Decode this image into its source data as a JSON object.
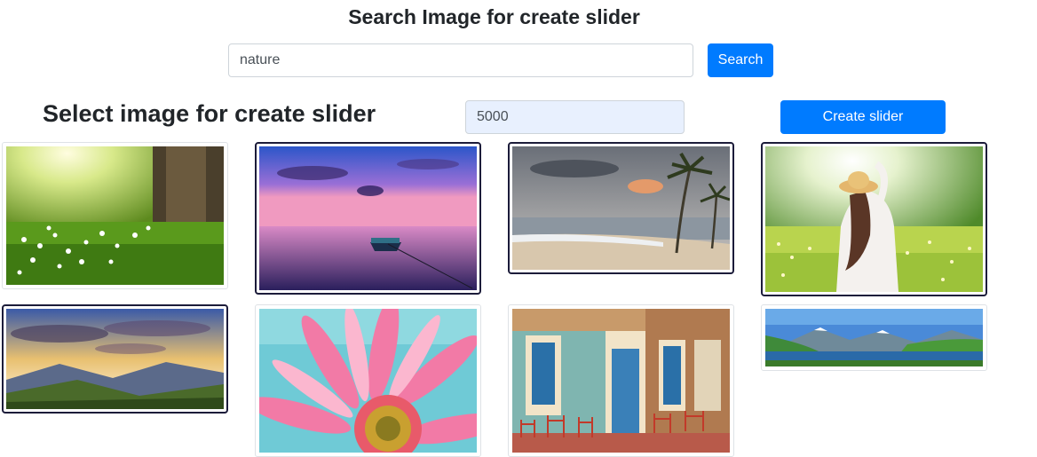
{
  "search": {
    "title": "Search Image for create slider",
    "input_value": "nature",
    "button_label": "Search"
  },
  "slider": {
    "title": "Select image for create slider",
    "duration_value": "5000",
    "button_label": "Create slider"
  },
  "gallery": {
    "images": [
      {
        "subject": "sunlit forest meadow with white flowers",
        "selected": false
      },
      {
        "subject": "boat on lake at pink sunset",
        "selected": true
      },
      {
        "subject": "tropical beach with palm trees",
        "selected": true
      },
      {
        "subject": "woman with hat in flower meadow",
        "selected": true
      },
      {
        "subject": "sunrays over mountain valley",
        "selected": true
      },
      {
        "subject": "pink daisy flower close-up",
        "selected": false
      },
      {
        "subject": "colorful cafe street facade",
        "selected": false
      },
      {
        "subject": "mountain lake panorama",
        "selected": false
      }
    ]
  },
  "colors": {
    "primary": "#007bff",
    "selected_border": "#1c1c3a",
    "autofill_bg": "#e8f0fe"
  }
}
